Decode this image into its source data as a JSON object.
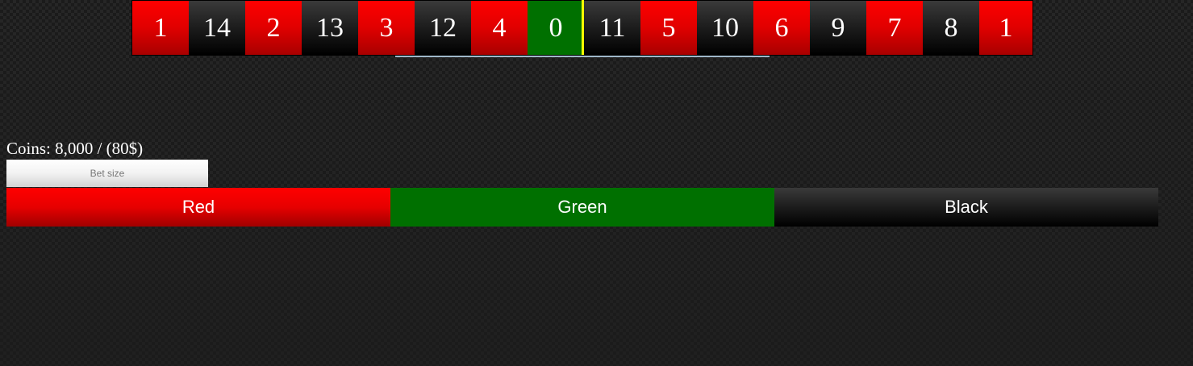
{
  "wheel": {
    "tiles": [
      {
        "number": "1",
        "color": "red"
      },
      {
        "number": "14",
        "color": "black"
      },
      {
        "number": "2",
        "color": "red"
      },
      {
        "number": "13",
        "color": "black"
      },
      {
        "number": "3",
        "color": "red"
      },
      {
        "number": "12",
        "color": "black"
      },
      {
        "number": "4",
        "color": "red"
      },
      {
        "number": "0",
        "color": "green"
      },
      {
        "number": "11",
        "color": "black"
      },
      {
        "number": "5",
        "color": "red"
      },
      {
        "number": "10",
        "color": "black"
      },
      {
        "number": "6",
        "color": "red"
      },
      {
        "number": "9",
        "color": "black"
      },
      {
        "number": "7",
        "color": "red"
      },
      {
        "number": "8",
        "color": "black"
      },
      {
        "number": "1",
        "color": "red"
      }
    ],
    "marker_color": "#ffff00"
  },
  "balance": {
    "text": "Coins: 8,000 / (80$)"
  },
  "bet": {
    "placeholder": "Bet size"
  },
  "buttons": {
    "red": "Red",
    "green": "Green",
    "black": "Black"
  },
  "colors": {
    "red": "#ff0000",
    "green": "#007000",
    "black": "#1c1c1c",
    "marker": "#ffff00"
  }
}
